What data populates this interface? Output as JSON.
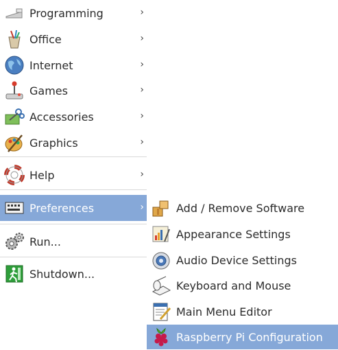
{
  "main_menu": {
    "items": [
      {
        "id": "programming",
        "label": "Programming",
        "chevron": "›",
        "icon": "programming-icon"
      },
      {
        "id": "office",
        "label": "Office",
        "chevron": "›",
        "icon": "office-icon"
      },
      {
        "id": "internet",
        "label": "Internet",
        "chevron": "›",
        "icon": "internet-globe-icon"
      },
      {
        "id": "games",
        "label": "Games",
        "chevron": "›",
        "icon": "joystick-icon"
      },
      {
        "id": "accessories",
        "label": "Accessories",
        "chevron": "›",
        "icon": "accessories-icon"
      },
      {
        "id": "graphics",
        "label": "Graphics",
        "chevron": "›",
        "icon": "graphics-palette-icon"
      },
      {
        "id": "help",
        "label": "Help",
        "chevron": "›",
        "icon": "help-lifebuoy-icon"
      },
      {
        "id": "preferences",
        "label": "Preferences",
        "chevron": "›",
        "icon": "preferences-icon",
        "selected": true
      },
      {
        "id": "run",
        "label": "Run...",
        "icon": "run-gears-icon"
      },
      {
        "id": "shutdown",
        "label": "Shutdown...",
        "icon": "shutdown-exit-icon"
      }
    ]
  },
  "preferences_submenu": {
    "items": [
      {
        "id": "add-remove-software",
        "label": "Add / Remove Software",
        "icon": "package-icon"
      },
      {
        "id": "appearance-settings",
        "label": "Appearance Settings",
        "icon": "appearance-icon"
      },
      {
        "id": "audio-device-settings",
        "label": "Audio Device Settings",
        "icon": "audio-icon"
      },
      {
        "id": "keyboard-and-mouse",
        "label": "Keyboard and Mouse",
        "icon": "keyboard-mouse-icon"
      },
      {
        "id": "main-menu-editor",
        "label": "Main Menu Editor",
        "icon": "menu-editor-icon"
      },
      {
        "id": "raspberry-pi-configuration",
        "label": "Raspberry Pi Configuration",
        "icon": "raspberry-icon",
        "selected": true
      }
    ]
  },
  "colors": {
    "selection": "#86a8d8",
    "separator": "#d9d9d9"
  }
}
